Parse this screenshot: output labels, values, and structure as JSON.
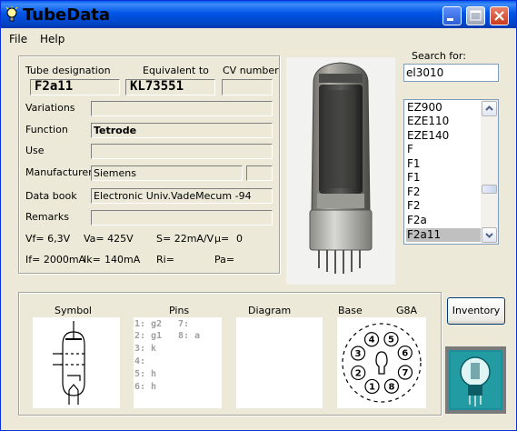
{
  "window": {
    "title": "TubeData"
  },
  "menu": {
    "file": "File",
    "help": "Help"
  },
  "info": {
    "tube_designation_label": "Tube designation",
    "equivalent_label": "Equivalent to",
    "cv_label": "CV number",
    "designation": "F2a11",
    "equivalent": "KL73551",
    "cv_number": "",
    "variations_label": "Variations",
    "variations": "",
    "function_label": "Function",
    "function": "Tetrode",
    "use_label": "Use",
    "use": "",
    "manufacturer_label": "Manufacturer",
    "manufacturer": "Siemens",
    "manufacturer_extra": "",
    "databook_label": "Data book",
    "databook": "Electronic Univ.VadeMecum -94",
    "remarks_label": "Remarks",
    "remarks": "",
    "vf": "Vf= 6,3V",
    "va": "Va= 425V",
    "s": "S= 22mA/V",
    "mu": "µ=",
    "mu_value": "0",
    "if": "If= 2000mA",
    "ik": "Ik=",
    "ik_value": "140mA",
    "ri": "Ri=",
    "pa": "Pa="
  },
  "search": {
    "label": "Search for:",
    "value": "el3010"
  },
  "tube_list": {
    "items": [
      "EZ900",
      "EZE110",
      "EZE140",
      "F",
      "F1",
      "F1",
      "F2",
      "F2",
      "F2a",
      "F2a11"
    ],
    "selected": "F2a11"
  },
  "pictures": {
    "symbol_label": "Symbol",
    "pins_label": "Pins",
    "diagram_label": "Diagram",
    "base_label": "Base",
    "base_type": "G8A",
    "pins_left": [
      "1: g2",
      "2: g1",
      "3: k",
      "4:",
      "5: h",
      "6: h"
    ],
    "pins_right": [
      "7:",
      "8: a"
    ],
    "base_pin_numbers": [
      "1",
      "2",
      "3",
      "4",
      "5",
      "6",
      "7",
      "8"
    ]
  },
  "buttons": {
    "inventory": "Inventory"
  },
  "icons": {
    "app": "lightbulb-icon",
    "minimize": "minimize-icon",
    "maximize": "maximize-icon",
    "close": "close-icon",
    "scroll_up": "chevron-up-icon",
    "scroll_down": "chevron-down-icon"
  },
  "colors": {
    "titlebar": "#0055e5",
    "window_bg": "#ece9d8",
    "close_button": "#c93b1d",
    "list_selection": "#c0c0c0"
  }
}
